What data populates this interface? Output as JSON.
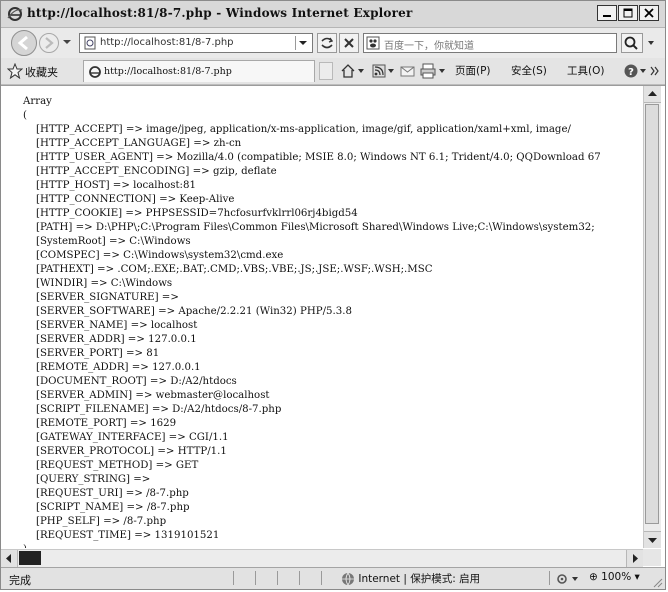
{
  "window": {
    "title": "http://localhost:81/8-7.php - Windows Internet Explorer"
  },
  "address_bar": {
    "url": "http://localhost:81/8-7.php",
    "search_placeholder": "百度一下，你就知道"
  },
  "favorites_bar": {
    "favorites_label": "收藏夹",
    "tab_title": "http://localhost:81/8-7.php"
  },
  "command_bar": {
    "page_menu": "页面(P)",
    "safety_menu": "安全(S)",
    "tools_menu": "工具(O)"
  },
  "content": {
    "open_line": "Array",
    "open_paren": "(",
    "close_paren": ")",
    "entries": [
      {
        "key": "[HTTP_ACCEPT]",
        "value": "image/jpeg, application/x-ms-application, image/gif, application/xaml+xml, image/"
      },
      {
        "key": "[HTTP_ACCEPT_LANGUAGE]",
        "value": "zh-cn"
      },
      {
        "key": "[HTTP_USER_AGENT]",
        "value": "Mozilla/4.0 (compatible; MSIE 8.0; Windows NT 6.1; Trident/4.0; QQDownload 67"
      },
      {
        "key": "[HTTP_ACCEPT_ENCODING]",
        "value": "gzip, deflate"
      },
      {
        "key": "[HTTP_HOST]",
        "value": "localhost:81"
      },
      {
        "key": "[HTTP_CONNECTION]",
        "value": "Keep-Alive"
      },
      {
        "key": "[HTTP_COOKIE]",
        "value": "PHPSESSID=7hcfosurfvklrrl06rj4bigd54"
      },
      {
        "key": "[PATH]",
        "value": "D:\\PHP\\;C:\\Program Files\\Common Files\\Microsoft Shared\\Windows Live;C:\\Windows\\system32;"
      },
      {
        "key": "[SystemRoot]",
        "value": "C:\\Windows"
      },
      {
        "key": "[COMSPEC]",
        "value": "C:\\Windows\\system32\\cmd.exe"
      },
      {
        "key": "[PATHEXT]",
        "value": ".COM;.EXE;.BAT;.CMD;.VBS;.VBE;.JS;.JSE;.WSF;.WSH;.MSC"
      },
      {
        "key": "[WINDIR]",
        "value": "C:\\Windows"
      },
      {
        "key": "[SERVER_SIGNATURE]",
        "value": ""
      },
      {
        "key": "[SERVER_SOFTWARE]",
        "value": "Apache/2.2.21 (Win32) PHP/5.3.8"
      },
      {
        "key": "[SERVER_NAME]",
        "value": "localhost"
      },
      {
        "key": "[SERVER_ADDR]",
        "value": "127.0.0.1"
      },
      {
        "key": "[SERVER_PORT]",
        "value": "81"
      },
      {
        "key": "[REMOTE_ADDR]",
        "value": "127.0.0.1"
      },
      {
        "key": "[DOCUMENT_ROOT]",
        "value": "D:/A2/htdocs"
      },
      {
        "key": "[SERVER_ADMIN]",
        "value": "webmaster@localhost"
      },
      {
        "key": "[SCRIPT_FILENAME]",
        "value": "D:/A2/htdocs/8-7.php"
      },
      {
        "key": "[REMOTE_PORT]",
        "value": "1629"
      },
      {
        "key": "[GATEWAY_INTERFACE]",
        "value": "CGI/1.1"
      },
      {
        "key": "[SERVER_PROTOCOL]",
        "value": "HTTP/1.1"
      },
      {
        "key": "[REQUEST_METHOD]",
        "value": "GET"
      },
      {
        "key": "[QUERY_STRING]",
        "value": ""
      },
      {
        "key": "[REQUEST_URI]",
        "value": "/8-7.php"
      },
      {
        "key": "[SCRIPT_NAME]",
        "value": "/8-7.php"
      },
      {
        "key": "[PHP_SELF]",
        "value": "/8-7.php"
      },
      {
        "key": "[REQUEST_TIME]",
        "value": "1319101521"
      }
    ]
  },
  "status_bar": {
    "status": "完成",
    "zone": "Internet | 保护模式: 启用",
    "zoom": "100%"
  },
  "icons": [
    "ie-icon",
    "back-icon",
    "forward-icon",
    "page-icon",
    "refresh-icon",
    "stop-icon",
    "baidu-icon",
    "search-icon",
    "star-icon",
    "home-icon",
    "feeds-icon",
    "mail-icon",
    "print-icon",
    "help-icon",
    "globe-icon"
  ]
}
